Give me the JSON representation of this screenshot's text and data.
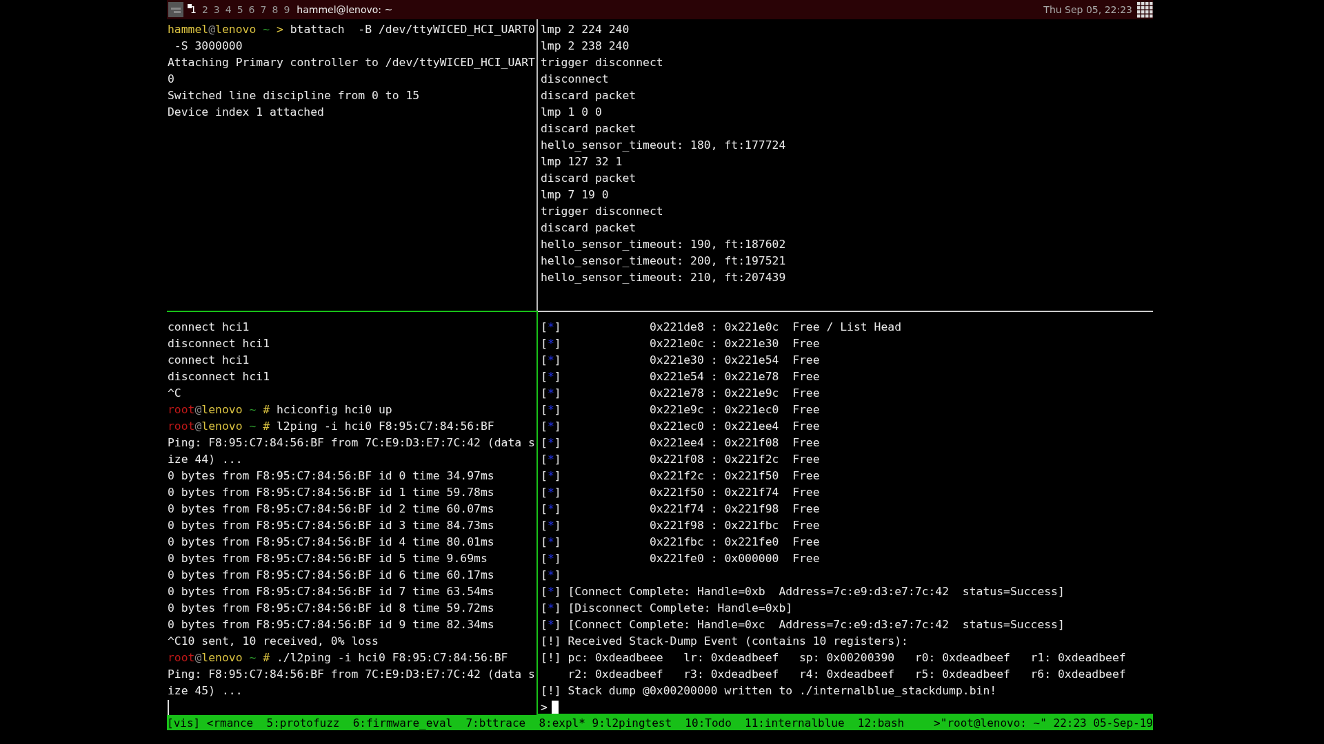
{
  "top_bar": {
    "workspaces": [
      {
        "label": "1",
        "selected": true
      },
      {
        "label": "2",
        "selected": false
      },
      {
        "label": "3",
        "selected": false
      },
      {
        "label": "4",
        "selected": false
      },
      {
        "label": "5",
        "selected": false
      },
      {
        "label": "6",
        "selected": false
      },
      {
        "label": "7",
        "selected": false
      },
      {
        "label": "8",
        "selected": false
      },
      {
        "label": "9",
        "selected": false
      }
    ],
    "window_title": "hammel@lenovo: ~",
    "clock": "Thu Sep 05, 22:23"
  },
  "panes": {
    "top_left": [
      {
        "kind": "user_prompt",
        "user": "hammel",
        "at": "@",
        "host": "lenovo",
        "dir": "~",
        "symbol": ">",
        "command": "btattach  -B /dev/ttyWICED_HCI_UART0"
      },
      {
        "kind": "output",
        "text": " -S 3000000"
      },
      {
        "kind": "output",
        "text": "Attaching Primary controller to /dev/ttyWICED_HCI_UART"
      },
      {
        "kind": "output",
        "text": "0"
      },
      {
        "kind": "output",
        "text": "Switched line discipline from 0 to 15"
      },
      {
        "kind": "output",
        "text": "Device index 1 attached"
      }
    ],
    "top_right": [
      {
        "kind": "output",
        "text": "lmp 2 224 240"
      },
      {
        "kind": "output",
        "text": "lmp 2 238 240"
      },
      {
        "kind": "output",
        "text": "trigger disconnect"
      },
      {
        "kind": "output",
        "text": "disconnect"
      },
      {
        "kind": "output",
        "text": "discard packet"
      },
      {
        "kind": "output",
        "text": "lmp 1 0 0"
      },
      {
        "kind": "output",
        "text": "discard packet"
      },
      {
        "kind": "output",
        "text": "hello_sensor_timeout: 180, ft:177724"
      },
      {
        "kind": "output",
        "text": "lmp 127 32 1"
      },
      {
        "kind": "output",
        "text": "discard packet"
      },
      {
        "kind": "output",
        "text": "lmp 7 19 0"
      },
      {
        "kind": "output",
        "text": "trigger disconnect"
      },
      {
        "kind": "output",
        "text": "discard packet"
      },
      {
        "kind": "output",
        "text": "hello_sensor_timeout: 190, ft:187602"
      },
      {
        "kind": "output",
        "text": "hello_sensor_timeout: 200, ft:197521"
      },
      {
        "kind": "output",
        "text": "hello_sensor_timeout: 210, ft:207439"
      }
    ],
    "bottom_left": [
      {
        "kind": "output",
        "text": "connect hci1"
      },
      {
        "kind": "output",
        "text": "disconnect hci1"
      },
      {
        "kind": "output",
        "text": "connect hci1"
      },
      {
        "kind": "output",
        "text": "disconnect hci1"
      },
      {
        "kind": "output",
        "text": "^C"
      },
      {
        "kind": "root_prompt",
        "user": "root",
        "at": "@",
        "host": "lenovo",
        "dir": "~",
        "symbol": "#",
        "command": "hciconfig hci0 up"
      },
      {
        "kind": "root_prompt",
        "user": "root",
        "at": "@",
        "host": "lenovo",
        "dir": "~",
        "symbol": "#",
        "command": "l2ping -i hci0 F8:95:C7:84:56:BF"
      },
      {
        "kind": "output",
        "text": "Ping: F8:95:C7:84:56:BF from 7C:E9:D3:E7:7C:42 (data s"
      },
      {
        "kind": "output",
        "text": "ize 44) ..."
      },
      {
        "kind": "output",
        "text": "0 bytes from F8:95:C7:84:56:BF id 0 time 34.97ms"
      },
      {
        "kind": "output",
        "text": "0 bytes from F8:95:C7:84:56:BF id 1 time 59.78ms"
      },
      {
        "kind": "output",
        "text": "0 bytes from F8:95:C7:84:56:BF id 2 time 60.07ms"
      },
      {
        "kind": "output",
        "text": "0 bytes from F8:95:C7:84:56:BF id 3 time 84.73ms"
      },
      {
        "kind": "output",
        "text": "0 bytes from F8:95:C7:84:56:BF id 4 time 80.01ms"
      },
      {
        "kind": "output",
        "text": "0 bytes from F8:95:C7:84:56:BF id 5 time 9.69ms"
      },
      {
        "kind": "output",
        "text": "0 bytes from F8:95:C7:84:56:BF id 6 time 60.17ms"
      },
      {
        "kind": "output",
        "text": "0 bytes from F8:95:C7:84:56:BF id 7 time 63.54ms"
      },
      {
        "kind": "output",
        "text": "0 bytes from F8:95:C7:84:56:BF id 8 time 59.72ms"
      },
      {
        "kind": "output",
        "text": "0 bytes from F8:95:C7:84:56:BF id 9 time 82.34ms"
      },
      {
        "kind": "output",
        "text": "^C10 sent, 10 received, 0% loss"
      },
      {
        "kind": "root_prompt",
        "user": "root",
        "at": "@",
        "host": "lenovo",
        "dir": "~",
        "symbol": "#",
        "command": "./l2ping -i hci0 F8:95:C7:84:56:BF"
      },
      {
        "kind": "output",
        "text": "Ping: F8:95:C7:84:56:BF from 7C:E9:D3:E7:7C:42 (data s"
      },
      {
        "kind": "output",
        "text": "ize 45) ..."
      },
      {
        "kind": "cursor"
      }
    ],
    "bottom_right": [
      {
        "kind": "info",
        "marker": "[*]",
        "text": "            0x221de8 : 0x221e0c  Free / List Head"
      },
      {
        "kind": "info",
        "marker": "[*]",
        "text": "            0x221e0c : 0x221e30  Free"
      },
      {
        "kind": "info",
        "marker": "[*]",
        "text": "            0x221e30 : 0x221e54  Free"
      },
      {
        "kind": "info",
        "marker": "[*]",
        "text": "            0x221e54 : 0x221e78  Free"
      },
      {
        "kind": "info",
        "marker": "[*]",
        "text": "            0x221e78 : 0x221e9c  Free"
      },
      {
        "kind": "info",
        "marker": "[*]",
        "text": "            0x221e9c : 0x221ec0  Free"
      },
      {
        "kind": "info",
        "marker": "[*]",
        "text": "            0x221ec0 : 0x221ee4  Free"
      },
      {
        "kind": "info",
        "marker": "[*]",
        "text": "            0x221ee4 : 0x221f08  Free"
      },
      {
        "kind": "info",
        "marker": "[*]",
        "text": "            0x221f08 : 0x221f2c  Free"
      },
      {
        "kind": "info",
        "marker": "[*]",
        "text": "            0x221f2c : 0x221f50  Free"
      },
      {
        "kind": "info",
        "marker": "[*]",
        "text": "            0x221f50 : 0x221f74  Free"
      },
      {
        "kind": "info",
        "marker": "[*]",
        "text": "            0x221f74 : 0x221f98  Free"
      },
      {
        "kind": "info",
        "marker": "[*]",
        "text": "            0x221f98 : 0x221fbc  Free"
      },
      {
        "kind": "info",
        "marker": "[*]",
        "text": "            0x221fbc : 0x221fe0  Free"
      },
      {
        "kind": "info",
        "marker": "[*]",
        "text": "            0x221fe0 : 0x000000  Free"
      },
      {
        "kind": "info",
        "marker": "[*]"
      },
      {
        "kind": "info",
        "marker": "[*]",
        "text": "[Connect Complete: Handle=0xb  Address=7c:e9:d3:e7:7c:42  status=Success]"
      },
      {
        "kind": "info",
        "marker": "[*]",
        "text": "[Disconnect Complete: Handle=0xb]"
      },
      {
        "kind": "info",
        "marker": "[*]",
        "text": "[Connect Complete: Handle=0xc  Address=7c:e9:d3:e7:7c:42  status=Success]"
      },
      {
        "kind": "warn",
        "marker": "[!]",
        "text": "Received Stack-Dump Event (contains 10 registers):"
      },
      {
        "kind": "warn",
        "marker": "[!]",
        "text": "pc: 0xdeadbeee   lr: 0xdeadbeef   sp: 0x00200390   r0: 0xdeadbeef   r1: 0xdeadbeef"
      },
      {
        "kind": "output",
        "text": "    r2: 0xdeadbeef   r3: 0xdeadbeef   r4: 0xdeadbeef   r5: 0xdeadbeef   r6: 0xdeadbeef"
      },
      {
        "kind": "warn",
        "marker": "[!]",
        "text": "Stack dump @0x00200000 written to ./internalblue_stackdump.bin!"
      },
      {
        "kind": "input",
        "text": ">"
      }
    ]
  },
  "status_bar": {
    "left": "[vis] <rmance  5:protofuzz  6:firmware_eval  7:bttrace  8:expl* 9:l2pingtest  10:Todo  11:internalblue  12:bash",
    "right": ">\"root@lenovo: ~\" 22:23 05-Sep-19"
  }
}
